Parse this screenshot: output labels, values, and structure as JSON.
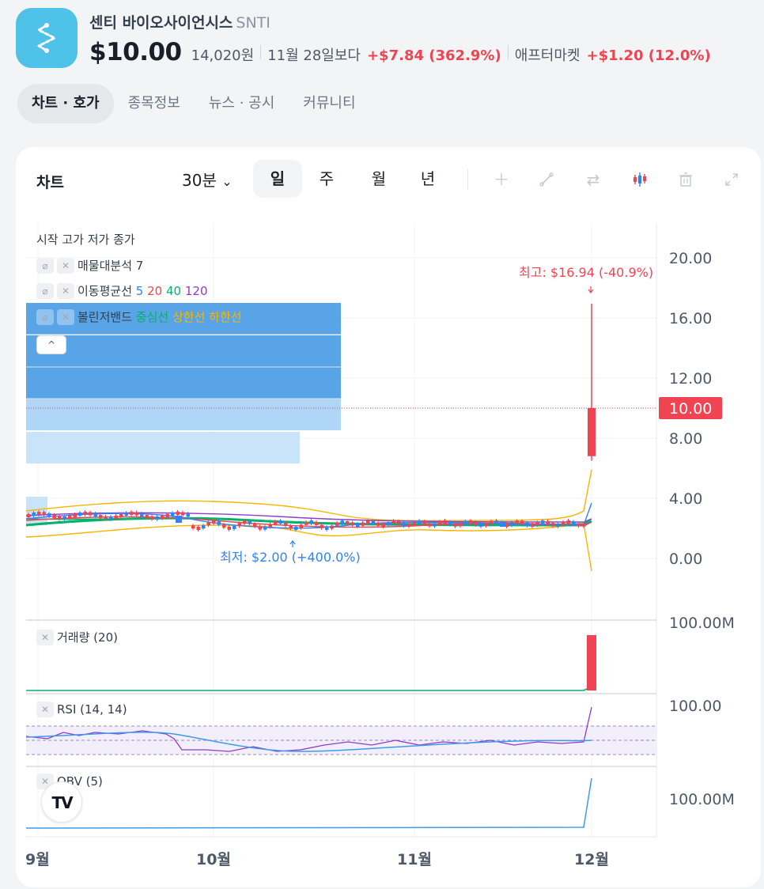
{
  "header": {
    "name": "센티 바이오사이언시스",
    "ticker": "SNTI",
    "price": "$10.00",
    "price_krw": "14,020원",
    "compare_label": "11월 28일보다",
    "change": "+$7.84 (362.9%)",
    "after_label": "애프터마켓",
    "after_change": "+$1.20 (12.0%)"
  },
  "tabs": [
    "차트 · 호가",
    "종목정보",
    "뉴스 · 공시",
    "커뮤니티"
  ],
  "toolbar": {
    "title": "차트",
    "interval": "30분",
    "ranges": [
      "일",
      "주",
      "월",
      "년"
    ]
  },
  "icons": {
    "logo": "s-route-logo-icon",
    "interval_caret": "chevron-down-icon",
    "tools": [
      "plus-icon",
      "trendline-icon",
      "swap-icon",
      "candlestick-icon",
      "trash-icon",
      "expand-icon"
    ],
    "tv": "tradingview-logo-icon"
  },
  "colors": {
    "up": "#f04452",
    "down": "#3182f6",
    "accent": "#4ec2e8",
    "ma5": "#3182f6",
    "ma20": "#f04452",
    "ma40": "#03b26c",
    "ma120": "#8f3cc7",
    "bb_mid": "#03b26c",
    "bb_band": "#f7b500"
  },
  "legend": {
    "ohlc": "시작 고가 저가 종가",
    "volume_profile": "매물대분석",
    "volume_profile_param": "7",
    "ma_label": "이동평균선",
    "ma_periods": [
      "5",
      "20",
      "40",
      "120"
    ],
    "bb_label": "볼린저밴드",
    "bb_mid": "중심선",
    "bb_upper": "상한선",
    "bb_lower": "하한선",
    "collapse": "^"
  },
  "indicators": {
    "volume": "거래량 (20)",
    "rsi": "RSI (14, 14)",
    "obv": "OBV (5)"
  },
  "chart_data": {
    "type": "candlestick",
    "price_axis": {
      "ticks": [
        "20.00",
        "16.00",
        "12.00",
        "8.00",
        "4.00",
        "0.00"
      ],
      "range": [
        0,
        20
      ],
      "current": "10.00"
    },
    "x_ticks": [
      "9월",
      "10월",
      "11월",
      "12월"
    ],
    "annotations": {
      "high": "최고: $16.94 (-40.9%)",
      "low": "최저: $2.00 (+400.0%)"
    },
    "last_candle": {
      "open": 6.8,
      "high": 16.94,
      "low": 6.5,
      "close": 10.0
    },
    "volume_axis": {
      "label": "100.00M"
    },
    "rsi_axis": {
      "label": "100.00"
    },
    "obv_axis": {
      "label": "100.00M"
    }
  }
}
